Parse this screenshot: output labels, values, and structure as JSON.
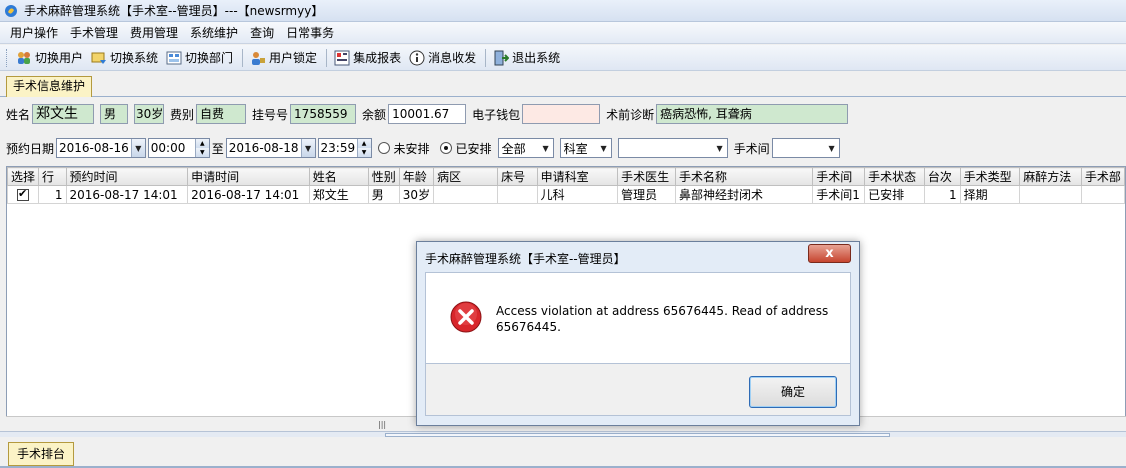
{
  "window": {
    "title": "手术麻醉管理系统【手术室--管理员】---【newsrmyy】"
  },
  "menu": [
    "用户操作",
    "手术管理",
    "费用管理",
    "系统维护",
    "查询",
    "日常事务"
  ],
  "toolbar": [
    {
      "label": "切换用户",
      "icon": "users-icon"
    },
    {
      "label": "切换系统",
      "icon": "switch-system-icon"
    },
    {
      "label": "切换部门",
      "icon": "switch-dept-icon"
    },
    {
      "label": "用户锁定",
      "icon": "lock-user-icon"
    },
    {
      "label": "集成报表",
      "icon": "report-icon"
    },
    {
      "label": "消息收发",
      "icon": "message-icon"
    },
    {
      "label": "退出系统",
      "icon": "exit-icon"
    }
  ],
  "tabs": {
    "main": "手术信息维护",
    "bottom": "手术排台"
  },
  "patient": {
    "name_label": "姓名",
    "name": "郑文生",
    "sex": "男",
    "age": "30岁",
    "fee_label": "费别",
    "fee": "自费",
    "reg_label": "挂号号",
    "reg": "1758559",
    "balance_label": "余额",
    "balance": "10001.67",
    "wallet_label": "电子钱包",
    "wallet": "",
    "diag_label": "术前诊断",
    "diag": "癌病恐怖, 耳聋病"
  },
  "filters": {
    "date_label": "预约日期",
    "date_from": "2016-08-16",
    "time_from": "00:00",
    "to_label": "至",
    "date_to": "2016-08-18",
    "time_to": "23:59",
    "radio_unscheduled": "未安排",
    "radio_scheduled": "已安排",
    "all_value": "全部",
    "dept_value": "科室",
    "dept2_value": "",
    "room_label": "手术间",
    "room_value": ""
  },
  "table": {
    "headers": [
      "选择",
      "行",
      "预约时间",
      "申请时间",
      "姓名",
      "性别",
      "年龄",
      "病区",
      "床号",
      "申请科室",
      "手术医生",
      "手术名称",
      "手术间",
      "手术状态",
      "台次",
      "手术类型",
      "麻醉方法",
      "手术部"
    ],
    "rows": [
      [
        "",
        "1",
        "2016-08-17 14:01",
        "2016-08-17 14:01",
        "郑文生",
        "男",
        "30岁",
        "",
        "",
        "儿科",
        "管理员",
        "鼻部神经封闭术",
        "手术间1",
        "已安排",
        "1",
        "择期",
        "",
        ""
      ]
    ]
  },
  "dialog": {
    "title": "手术麻醉管理系统【手术室--管理员】",
    "close": "x",
    "message": "Access violation at address 65676445. Read of address 65676445.",
    "ok": "确定"
  }
}
